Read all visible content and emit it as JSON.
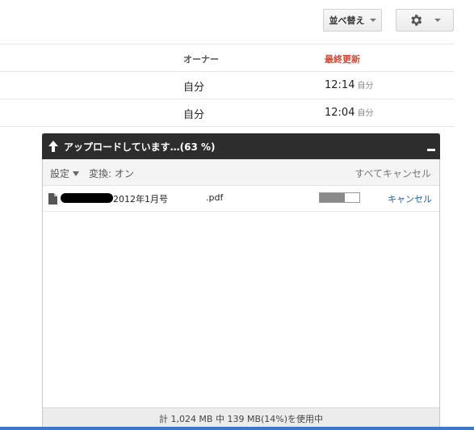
{
  "toolbar": {
    "sort_label": "並べ替え"
  },
  "columns": {
    "owner": "オーナー",
    "last_modified": "最終更新"
  },
  "rows": [
    {
      "owner": "自分",
      "time": "12:14",
      "by": "自分"
    },
    {
      "owner": "自分",
      "time": "12:04",
      "by": "自分"
    }
  ],
  "upload_panel": {
    "title": "アップロードしています…(63 %)",
    "settings_label": "設定",
    "convert_label": "変換: オン",
    "cancel_all_label": "すべてキャンセル",
    "file": {
      "name_part1": "2012年1月号",
      "name_part2": ".pdf",
      "progress_percent": 63,
      "cancel_label": "キャンセル"
    },
    "footer_text": "計 1,024 MB 中 139 MB(14%)を使用中"
  },
  "colors": {
    "accent_red": "#d14836",
    "link_blue": "#1f5fa6",
    "header_dark": "#2d2d2d"
  },
  "icons": [
    "chevron-down-icon",
    "gear-icon",
    "upload-arrow-icon",
    "minimize-icon",
    "document-icon"
  ]
}
